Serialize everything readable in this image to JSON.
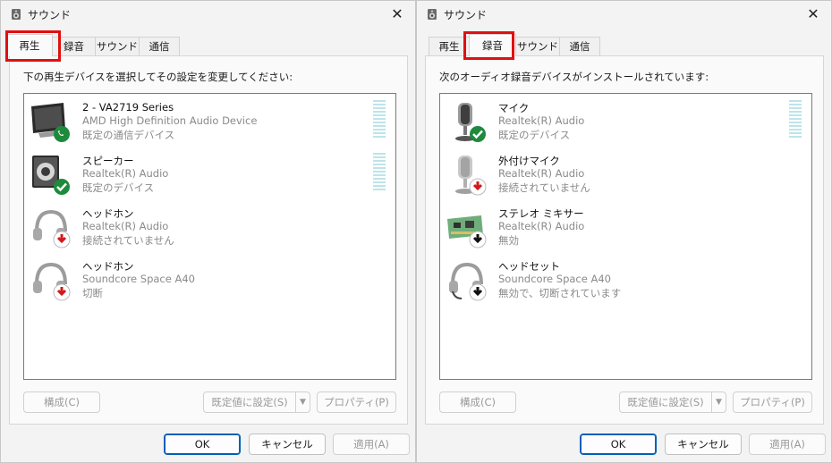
{
  "left_dialog": {
    "title": "サウンド",
    "close_glyph": "✕",
    "tabs": [
      "再生",
      "録音",
      "サウンド",
      "通信"
    ],
    "instruction": "下の再生デバイスを選択してその設定を変更してください:",
    "devices": [
      {
        "name": "2 - VA2719 Series",
        "sub": "AMD High Definition Audio Device",
        "status": "既定の通信デバイス",
        "icon": "monitor-icon",
        "badge": "phone-check-badge-icon"
      },
      {
        "name": "スピーカー",
        "sub": "Realtek(R) Audio",
        "status": "既定のデバイス",
        "icon": "speaker-icon",
        "badge": "check-badge-icon"
      },
      {
        "name": "ヘッドホン",
        "sub": "Realtek(R) Audio",
        "status": "接続されていません",
        "icon": "headphones-icon",
        "badge": "red-down-arrow-badge-icon"
      },
      {
        "name": "ヘッドホン",
        "sub": "Soundcore Space A40",
        "status": "切断",
        "icon": "headphones-icon",
        "badge": "red-down-arrow-badge-icon"
      }
    ],
    "buttons": {
      "configure": "構成(C)",
      "set_default": "既定値に設定(S)",
      "properties": "プロパティ(P)",
      "ok": "OK",
      "cancel": "キャンセル",
      "apply": "適用(A)"
    }
  },
  "right_dialog": {
    "title": "サウンド",
    "close_glyph": "✕",
    "tabs": [
      "再生",
      "録音",
      "サウンド",
      "通信"
    ],
    "instruction": "次のオーディオ録音デバイスがインストールされています:",
    "devices": [
      {
        "name": "マイク",
        "sub": "Realtek(R) Audio",
        "status": "既定のデバイス",
        "icon": "microphone-icon",
        "badge": "check-badge-icon"
      },
      {
        "name": "外付けマイク",
        "sub": "Realtek(R) Audio",
        "status": "接続されていません",
        "icon": "microphone-icon",
        "badge": "red-down-arrow-badge-icon"
      },
      {
        "name": "ステレオ ミキサー",
        "sub": "Realtek(R) Audio",
        "status": "無効",
        "icon": "circuit-board-icon",
        "badge": "black-down-arrow-badge-icon"
      },
      {
        "name": "ヘッドセット",
        "sub": "Soundcore Space A40",
        "status": "無効で、切断されています",
        "icon": "headset-icon",
        "badge": "black-down-arrow-badge-icon"
      }
    ],
    "buttons": {
      "configure": "構成(C)",
      "set_default": "既定値に設定(S)",
      "properties": "プロパティ(P)",
      "ok": "OK",
      "cancel": "キャンセル",
      "apply": "適用(A)"
    }
  },
  "colors": {
    "highlight": "#e01010",
    "ok_border": "#005fb8",
    "check_green": "#1e8a3c",
    "arrow_red": "#d01a1a",
    "meter": "#bde4ea"
  }
}
